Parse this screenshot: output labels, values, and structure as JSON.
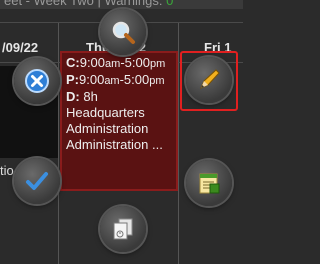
{
  "topbar": {
    "title": "eet - Week Two | Warnings: ",
    "warnings_count": "0"
  },
  "days": [
    {
      "label": "/09/22"
    },
    {
      "label": "Thu   09/22"
    },
    {
      "label": "Fri 1"
    }
  ],
  "left_cell": {
    "snippet": "tio"
  },
  "shift": {
    "c_label": "C:",
    "c_time_start": "9:00",
    "c_am": "am",
    "c_sep": "-5:00",
    "c_pm": "pm",
    "p_label": "P:",
    "p_time_start": "9:00",
    "p_am": "am",
    "p_sep": "-5:00",
    "p_pm": "pm",
    "d_label": "D:",
    "d_value": "8h",
    "location": "Headquarters",
    "department": "Administration",
    "role": "Administration ..."
  },
  "icons": {
    "search": "magnifier-icon",
    "close": "close-icon",
    "edit": "pencil-icon",
    "confirm": "checkmark-icon",
    "notes": "notes-icon",
    "copy": "copy-icon"
  },
  "colors": {
    "highlight": "#e02020",
    "card": "#5a1212"
  }
}
